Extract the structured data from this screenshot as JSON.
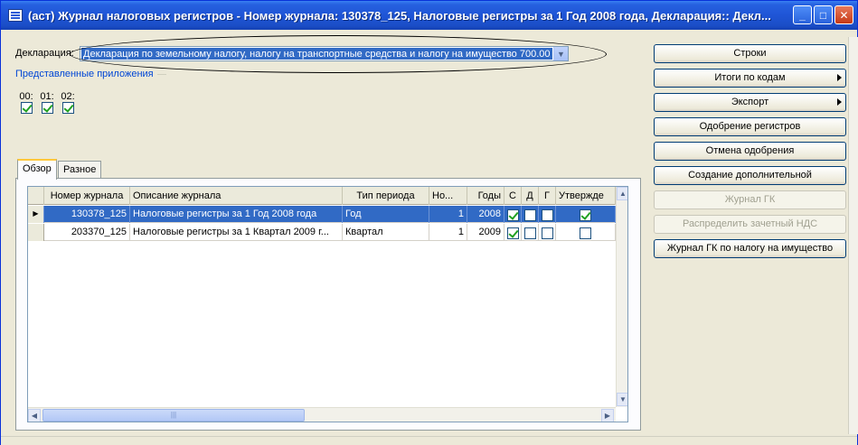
{
  "window": {
    "title": "(аст) Журнал налоговых регистров - Номер журнала: 130378_125, Налоговые регистры за 1 Год 2008 года, Декларация:: Декл...",
    "minimize": "_",
    "maximize": "□",
    "close": "✕"
  },
  "declaration": {
    "label": "Декларация:",
    "value": "Декларация по земельному налогу, налогу на транспортные средства и налогу на имущество 700.00",
    "arrow": "▼"
  },
  "appendices": {
    "legend": "Представленные приложения",
    "items": [
      {
        "label": "00:",
        "checked": true
      },
      {
        "label": "01:",
        "checked": true
      },
      {
        "label": "02:",
        "checked": true
      }
    ]
  },
  "tabs": [
    {
      "label": "Обзор",
      "active": true
    },
    {
      "label": "Разное",
      "active": false
    }
  ],
  "grid": {
    "columns": [
      "Номер журнала",
      "Описание журнала",
      "Тип периода",
      "Но...",
      "Годы",
      "С",
      "Д",
      "Г",
      "Утвержде"
    ],
    "rows": [
      {
        "selected": true,
        "indicator": "▶",
        "number": "130378_125",
        "description": "Налоговые регистры за 1 Год 2008 года",
        "period_type": "Год",
        "no": "1",
        "year": "2008",
        "c": true,
        "d": false,
        "g": false,
        "approved": true
      },
      {
        "selected": false,
        "indicator": "",
        "number": "203370_125",
        "description": "Налоговые регистры за 1 Квартал 2009 г...",
        "period_type": "Квартал",
        "no": "1",
        "year": "2009",
        "c": true,
        "d": false,
        "g": false,
        "approved": false
      }
    ]
  },
  "buttons": {
    "rows": "Строки",
    "totals_by_codes": "Итоги по кодам",
    "export": "Экспорт",
    "approve": "Одобрение регистров",
    "cancel_approve": "Отмена одобрения",
    "create_additional": "Создание дополнительной",
    "gl_journal": "Журнал ГК",
    "distribute_vat": "Распределить зачетный НДС",
    "gl_property_tax": "Журнал ГК по налогу на имущество"
  }
}
